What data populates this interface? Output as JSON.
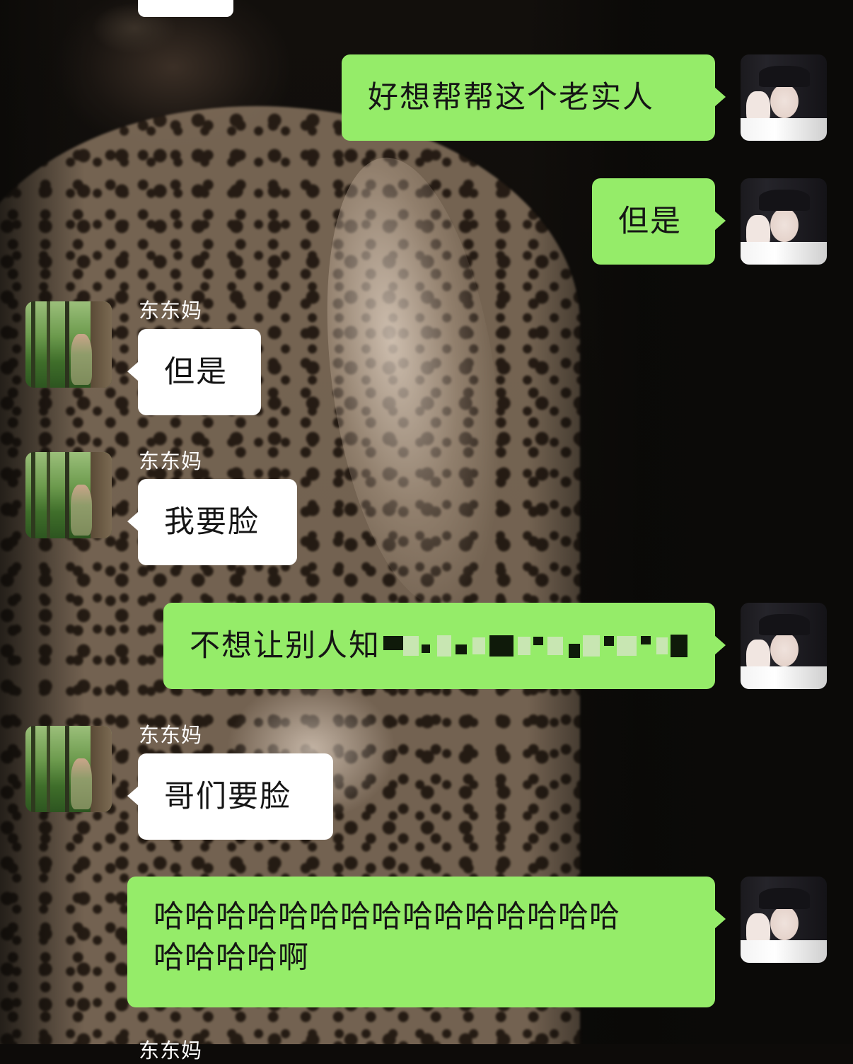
{
  "messages": [
    {
      "side": "me",
      "text": "好想帮帮这个老实人"
    },
    {
      "side": "me",
      "text": "但是"
    },
    {
      "side": "other",
      "sender": "东东妈",
      "text": "但是"
    },
    {
      "side": "other",
      "sender": "东东妈",
      "text": "我要脸"
    },
    {
      "side": "me",
      "text": "不想让别人知",
      "redacted": true
    },
    {
      "side": "other",
      "sender": "东东妈",
      "text": "哥们要脸"
    },
    {
      "side": "me",
      "text_line1": "哈哈哈哈哈哈哈哈哈哈哈哈哈哈哈",
      "text_line2": "哈哈哈哈啊"
    }
  ],
  "partial_sender": "东东妈",
  "colors": {
    "me_bubble": "#95ec69",
    "other_bubble": "#ffffff"
  }
}
